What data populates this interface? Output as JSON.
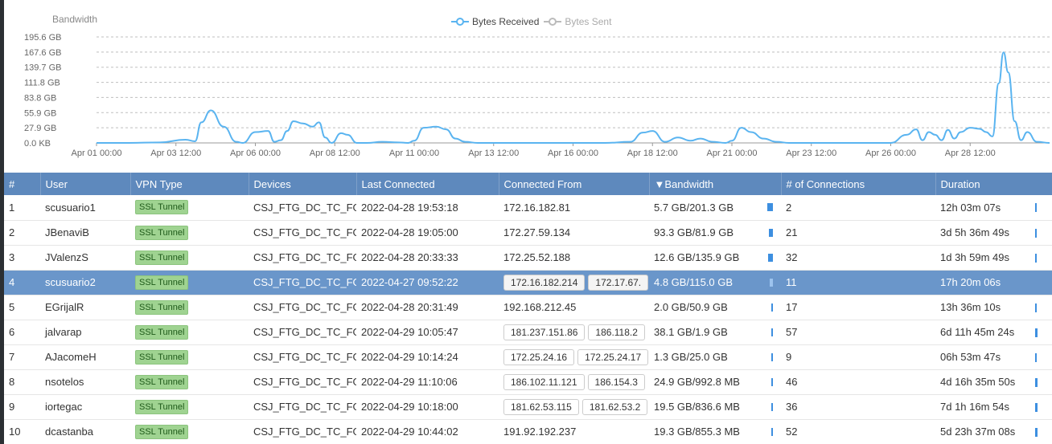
{
  "chart": {
    "title": "Bandwidth",
    "legend": [
      {
        "label": "Bytes Received",
        "color": "#5ab4f0",
        "active": true
      },
      {
        "label": "Bytes Sent",
        "color": "#bbbbbb",
        "active": false
      }
    ]
  },
  "chart_data": {
    "type": "line",
    "ylabel": "Bandwidth",
    "yticks": [
      "195.6 GB",
      "167.6 GB",
      "139.7 GB",
      "111.8 GB",
      "83.8 GB",
      "55.9 GB",
      "27.9 GB",
      "0.0 KB"
    ],
    "ylim_gb": [
      0,
      195.6
    ],
    "xticks": [
      "Apr 01 00:00",
      "Apr 03 12:00",
      "Apr 06 00:00",
      "Apr 08 12:00",
      "Apr 11 00:00",
      "Apr 13 12:00",
      "Apr 16 00:00",
      "Apr 18 12:00",
      "Apr 21 00:00",
      "Apr 23 12:00",
      "Apr 26 00:00",
      "Apr 28 12:00"
    ],
    "grid": true,
    "legend_position": "top-center",
    "series": [
      {
        "name": "Bytes Received",
        "x_days": [
          0,
          1.0,
          2.0,
          2.8,
          3.1,
          3.3,
          3.6,
          4.0,
          4.4,
          4.6,
          5.0,
          5.4,
          5.6,
          5.8,
          6.0,
          6.2,
          6.5,
          6.8,
          7.0,
          7.2,
          7.4,
          7.7,
          7.9,
          8.2,
          8.5,
          9.0,
          9.5,
          9.8,
          10.0,
          10.3,
          10.7,
          11.0,
          11.3,
          11.6,
          12.0,
          13.0,
          14.0,
          15.0,
          16.0,
          16.8,
          17.2,
          17.5,
          17.9,
          18.3,
          18.7,
          19.0,
          19.4,
          19.8,
          20.0,
          20.3,
          20.6,
          21.0,
          21.4,
          21.8,
          22.0,
          23.0,
          24.0,
          25.0,
          25.5,
          25.8,
          26.0,
          26.2,
          26.4,
          26.6,
          26.8,
          27.0,
          27.2,
          27.5,
          27.8,
          28.0,
          28.2,
          28.4,
          28.55,
          28.7,
          28.9,
          29.1,
          29.3,
          29.6,
          30.0
        ],
        "values_gb": [
          0,
          0,
          1,
          6,
          3,
          38,
          60,
          30,
          2,
          0,
          20,
          22,
          2,
          5,
          22,
          40,
          36,
          30,
          38,
          10,
          0,
          18,
          15,
          0,
          0,
          2,
          1,
          0,
          4,
          28,
          30,
          25,
          8,
          2,
          0,
          0,
          0,
          0,
          0,
          2,
          19,
          22,
          2,
          10,
          4,
          8,
          2,
          0,
          4,
          28,
          20,
          8,
          2,
          0,
          0,
          0,
          0,
          0,
          15,
          25,
          5,
          20,
          15,
          5,
          24,
          8,
          20,
          28,
          26,
          20,
          12,
          110,
          167,
          130,
          40,
          5,
          20,
          2,
          0
        ]
      },
      {
        "name": "Bytes Sent",
        "x_days": [],
        "values_gb": []
      }
    ]
  },
  "table": {
    "columns": [
      "#",
      "User",
      "VPN Type",
      "Devices",
      "Last Connected",
      "Connected From",
      "▼Bandwidth",
      "# of Connections",
      "Duration"
    ],
    "rows": [
      {
        "num": "1",
        "user": "scusuario1",
        "vpn": "SSL Tunnel",
        "device": "CSJ_FTG_DC_TC_FG",
        "last": "2022-04-28 19:53:18",
        "from": [
          "172.16.182.81"
        ],
        "bw": "5.7 GB/201.3 GB",
        "bw_frac": 0.9,
        "conn": "2",
        "dur": "12h 03m 07s",
        "dur_frac": 0.2
      },
      {
        "num": "2",
        "user": "JBenaviB",
        "vpn": "SSL Tunnel",
        "device": "CSJ_FTG_DC_TC_FG",
        "last": "2022-04-28 19:05:00",
        "from": [
          "172.27.59.134"
        ],
        "bw": "93.3 GB/81.9 GB",
        "bw_frac": 0.6,
        "conn": "21",
        "dur": "3d 5h 36m 49s",
        "dur_frac": 0.2
      },
      {
        "num": "3",
        "user": "JValenzS",
        "vpn": "SSL Tunnel",
        "device": "CSJ_FTG_DC_TC_FG",
        "last": "2022-04-28 20:33:33",
        "from": [
          "172.25.52.188"
        ],
        "bw": "12.6 GB/135.9 GB",
        "bw_frac": 0.7,
        "conn": "32",
        "dur": "1d 3h 59m 49s",
        "dur_frac": 0.2
      },
      {
        "num": "4",
        "user": "scusuario2",
        "vpn": "SSL Tunnel",
        "device": "CSJ_FTG_DC_TC_FG",
        "last": "2022-04-27 09:52:22",
        "from": [
          "172.16.182.214",
          "172.17.67."
        ],
        "bw": "4.8 GB/115.0 GB",
        "bw_frac": 0.5,
        "conn": "11",
        "dur": "17h 20m 06s",
        "dur_frac": 0.0,
        "selected": true
      },
      {
        "num": "5",
        "user": "EGrijalR",
        "vpn": "SSL Tunnel",
        "device": "CSJ_FTG_DC_TC_FG",
        "last": "2022-04-28 20:31:49",
        "from": [
          "192.168.212.45"
        ],
        "bw": "2.0 GB/50.9 GB",
        "bw_frac": 0.25,
        "conn": "17",
        "dur": "13h 36m 10s",
        "dur_frac": 0.0
      },
      {
        "num": "6",
        "user": "jalvarap",
        "vpn": "SSL Tunnel",
        "device": "CSJ_FTG_DC_TC_FG",
        "last": "2022-04-29 10:05:47",
        "from": [
          "181.237.151.86",
          "186.118.2"
        ],
        "bw": "38.1 GB/1.9 GB",
        "bw_frac": 0.1,
        "conn": "57",
        "dur": "6d 11h 45m 24s",
        "dur_frac": 0.4
      },
      {
        "num": "7",
        "user": "AJacomeH",
        "vpn": "SSL Tunnel",
        "device": "CSJ_FTG_DC_TC_FG",
        "last": "2022-04-29 10:14:24",
        "from": [
          "172.25.24.16",
          "172.25.24.17"
        ],
        "bw": "1.3 GB/25.0 GB",
        "bw_frac": 0.2,
        "conn": "9",
        "dur": "06h 53m 47s",
        "dur_frac": 0.0
      },
      {
        "num": "8",
        "user": "nsotelos",
        "vpn": "SSL Tunnel",
        "device": "CSJ_FTG_DC_TC_FG",
        "last": "2022-04-29 11:10:06",
        "from": [
          "186.102.11.121",
          "186.154.3"
        ],
        "bw": "24.9 GB/992.8 MB",
        "bw_frac": 0.15,
        "conn": "46",
        "dur": "4d 16h 35m 50s",
        "dur_frac": 0.4
      },
      {
        "num": "9",
        "user": "iortegac",
        "vpn": "SSL Tunnel",
        "device": "CSJ_FTG_DC_TC_FG",
        "last": "2022-04-29 10:18:00",
        "from": [
          "181.62.53.115",
          "181.62.53.2"
        ],
        "bw": "19.5 GB/836.6 MB",
        "bw_frac": 0.15,
        "conn": "36",
        "dur": "7d 1h 16m 54s",
        "dur_frac": 0.4
      },
      {
        "num": "10",
        "user": "dcastanba",
        "vpn": "SSL Tunnel",
        "device": "CSJ_FTG_DC_TC_FG",
        "last": "2022-04-29 10:44:02",
        "from": [
          "191.92.192.237"
        ],
        "bw": "19.3 GB/855.3 MB",
        "bw_frac": 0.15,
        "conn": "52",
        "dur": "5d 23h 37m 08s",
        "dur_frac": 0.4
      }
    ]
  }
}
